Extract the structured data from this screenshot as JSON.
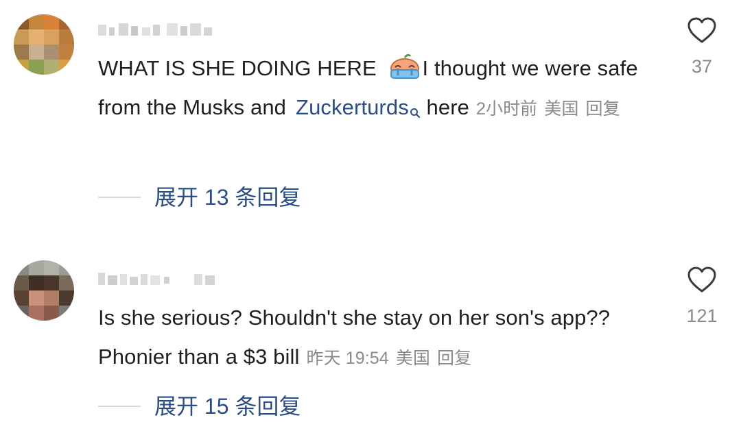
{
  "comments": [
    {
      "avatar_icon": "blurred-avatar",
      "username_icon": "blurred-username",
      "text_part1": "WHAT IS SHE DOING HERE ",
      "emoji_icon": "crying-face-emoji",
      "text_part2": "I thought we were safe from the Musks and",
      "mention": "Zuckerturds",
      "mention_icon": "search-icon",
      "text_part3": "here",
      "time": "2小时前",
      "location": "美国",
      "reply_label": "回复",
      "like_icon": "heart-outline-icon",
      "like_count": "37",
      "expand_label": "展开 13 条回复"
    },
    {
      "avatar_icon": "blurred-avatar",
      "username_icon": "blurred-username",
      "text_part1": "Is she serious? Shouldn't she stay on her son's app?? Phonier than a $3 bill",
      "time": "昨天 19:54",
      "location": "美国",
      "reply_label": "回复",
      "like_icon": "heart-outline-icon",
      "like_count": "121",
      "expand_label": "展开 15 条回复"
    }
  ],
  "colors": {
    "text": "#1f1f1f",
    "meta": "#8a8a8a",
    "link": "#2b4d86",
    "divider": "#d8d8d8"
  }
}
